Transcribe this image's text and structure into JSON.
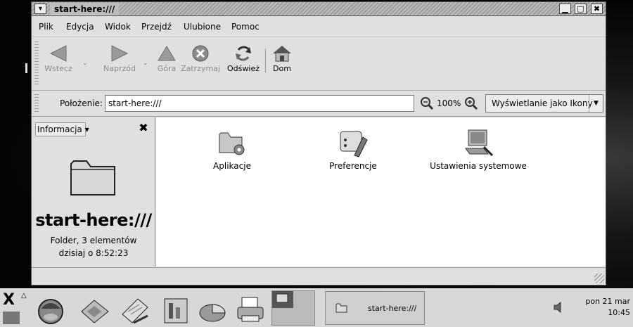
{
  "window": {
    "title": "start-here:///",
    "menu_button": "▾",
    "minimize": "▁",
    "maximize": "□",
    "close": "✖"
  },
  "menubar": {
    "items": [
      "Plik",
      "Edycja",
      "Widok",
      "Przejdź",
      "Ulubione",
      "Pomoc"
    ]
  },
  "toolbar": {
    "back": "Wstecz",
    "forward": "Naprzód",
    "up": "Góra",
    "stop": "Zatrzymaj",
    "reload": "Odśwież",
    "home": "Dom"
  },
  "location": {
    "label": "Położenie:",
    "value": "start-here:///",
    "zoom_level": "100%",
    "view_mode": "Wyświetlanie jako Ikony"
  },
  "sidepane": {
    "selector": "Informacja",
    "title": "start-here:///",
    "info_line1": "Folder, 3 elementów",
    "info_line2": "dzisiaj o 8:52:23"
  },
  "content": {
    "items": [
      {
        "label": "Aplikacje",
        "icon": "applications-folder-icon"
      },
      {
        "label": "Preferencje",
        "icon": "preferences-icon"
      },
      {
        "label": "Ustawienia systemowe",
        "icon": "system-settings-icon"
      }
    ]
  },
  "panel": {
    "x_label": "X",
    "task_label": "start-here:///",
    "clock_date": "pon 21 mar",
    "clock_time": "10:45"
  }
}
